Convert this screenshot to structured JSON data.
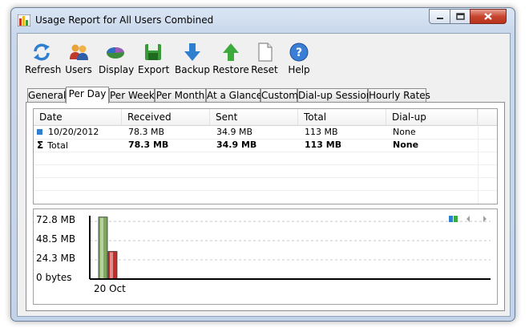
{
  "window": {
    "title": "Usage Report for All Users Combined"
  },
  "toolbar": {
    "buttons": [
      {
        "label": "Refresh",
        "icon": "refresh-icon"
      },
      {
        "label": "Users",
        "icon": "users-icon"
      },
      {
        "label": "Display",
        "icon": "display-icon"
      },
      {
        "label": "Export",
        "icon": "save-disk-icon"
      },
      {
        "label": "Backup",
        "icon": "down-arrow-icon"
      },
      {
        "label": "Restore",
        "icon": "up-arrow-icon"
      },
      {
        "label": "Reset",
        "icon": "blank-page-icon"
      },
      {
        "label": "Help",
        "icon": "help-icon"
      }
    ]
  },
  "tabs": [
    "General",
    "Per Day",
    "Per Week",
    "Per Month",
    "At a Glance",
    "Custom",
    "Dial-up Sessions",
    "Hourly Rates"
  ],
  "active_tab": "Per Day",
  "table": {
    "columns": [
      "Date",
      "Received",
      "Sent",
      "Total",
      "Dial-up"
    ],
    "rows": [
      {
        "date": "10/20/2012",
        "received": "78.3 MB",
        "sent": "34.9 MB",
        "total": "113 MB",
        "dialup": "None"
      }
    ],
    "total_row": {
      "symbol": "Σ",
      "label": "Total",
      "received": "78.3 MB",
      "sent": "34.9 MB",
      "total": "113 MB",
      "dialup": "None"
    }
  },
  "chart_data": {
    "type": "bar",
    "categories": [
      "20 Oct"
    ],
    "series": [
      {
        "values": [
          78.3
        ],
        "color": "#7ea85a"
      },
      {
        "values": [
          34.9
        ],
        "color": "#c0302a"
      }
    ],
    "yticks": [
      "0 bytes",
      "24.3 MB",
      "48.5 MB",
      "72.8 MB"
    ],
    "ytick_values": [
      0,
      24.3,
      48.5,
      72.8
    ],
    "ylim": [
      0,
      80
    ],
    "grid": true
  },
  "colors": {
    "received": "#7ea85a",
    "sent": "#c0302a",
    "row_marker": "#2f7fd0"
  }
}
